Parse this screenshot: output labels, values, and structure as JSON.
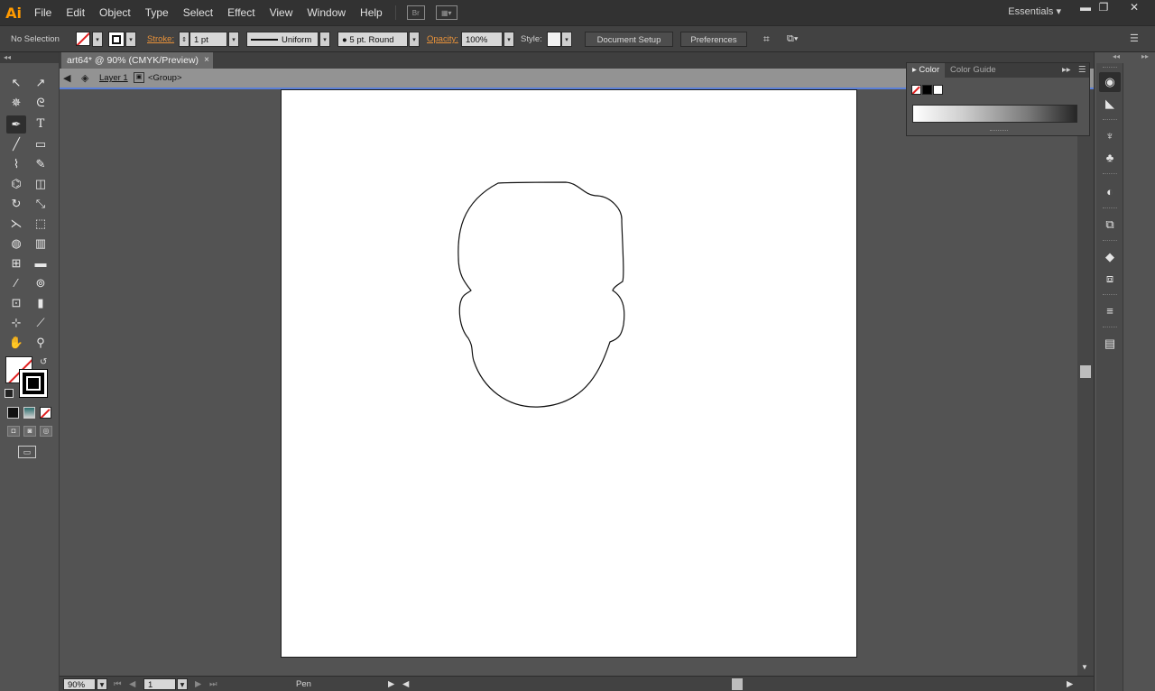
{
  "app": {
    "logo": "Ai",
    "menu": [
      "File",
      "Edit",
      "Object",
      "Type",
      "Select",
      "Effect",
      "View",
      "Window",
      "Help"
    ],
    "bridge_label": "Br",
    "workspace": "Essentials",
    "window_controls": {
      "minimize": "▬",
      "restore": "❐",
      "close": "✕"
    }
  },
  "control_bar": {
    "selection": "No Selection",
    "stroke_label": "Stroke:",
    "stroke_weight": "1 pt",
    "profile": "Uniform",
    "brush": "5 pt. Round",
    "opacity_label": "Opacity:",
    "opacity_value": "100%",
    "style_label": "Style:",
    "document_setup": "Document Setup",
    "preferences": "Preferences"
  },
  "document": {
    "tab_title": "art64* @ 90% (CMYK/Preview)",
    "close_glyph": "×",
    "breadcrumb": {
      "layer": "Layer 1",
      "group": "<Group>"
    }
  },
  "status": {
    "zoom": "90%",
    "artboard": "1",
    "tool": "Pen"
  },
  "color_panel": {
    "tabs": [
      "Color",
      "Color Guide"
    ]
  },
  "tools": [
    "selection-icon",
    "direct-selection-icon",
    "magic-wand-icon",
    "lasso-icon",
    "pen-icon",
    "type-icon",
    "line-icon",
    "rectangle-icon",
    "paintbrush-icon",
    "pencil-icon",
    "blob-brush-icon",
    "eraser-icon",
    "rotate-icon",
    "scale-icon",
    "width-icon",
    "free-transform-icon",
    "shape-builder-icon",
    "perspective-grid-icon",
    "mesh-icon",
    "gradient-icon",
    "eyedropper-icon",
    "blend-icon",
    "symbol-sprayer-icon",
    "column-graph-icon",
    "artboard-icon",
    "slice-icon",
    "hand-icon",
    "zoom-icon"
  ],
  "colors": {
    "accent_orange": "#e8923a",
    "selection_blue": "#5a7fd8",
    "none_red": "#e02020"
  }
}
